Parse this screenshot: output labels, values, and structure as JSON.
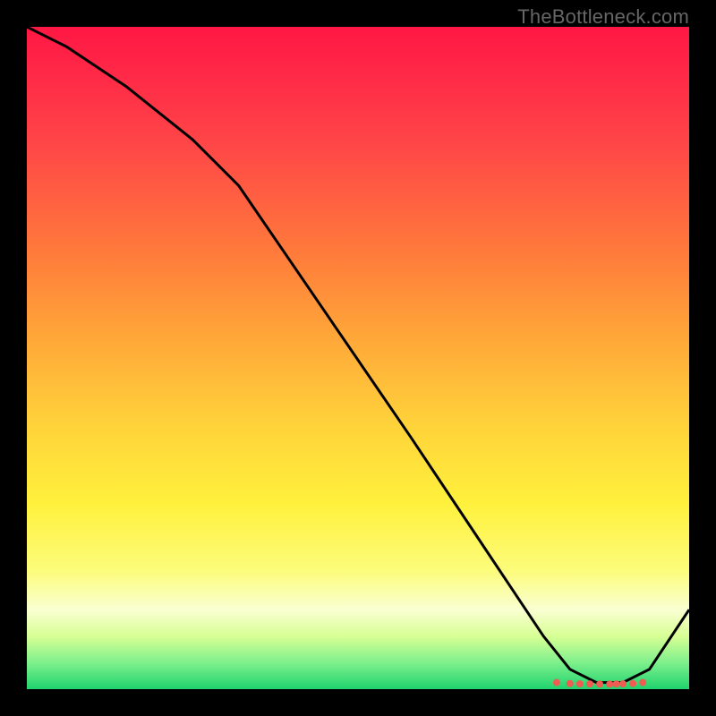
{
  "watermark": "TheBottleneck.com",
  "chart_data": {
    "type": "line",
    "title": "",
    "xlabel": "",
    "ylabel": "",
    "xlim": [
      0,
      100
    ],
    "ylim": [
      0,
      100
    ],
    "grid": false,
    "series": [
      {
        "name": "curve",
        "x": [
          0,
          6,
          15,
          25,
          32,
          45,
          58,
          70,
          78,
          82,
          86,
          90,
          94,
          100
        ],
        "values": [
          100,
          97,
          91,
          83,
          76,
          57,
          38,
          20,
          8,
          3,
          1,
          1,
          3,
          12
        ],
        "color": "#000000",
        "stroke_width": 3
      }
    ],
    "markers": {
      "x": [
        80,
        82,
        83.5,
        85,
        86.5,
        88,
        89,
        90,
        91.5,
        93
      ],
      "values": [
        1.0,
        0.85,
        0.8,
        0.78,
        0.76,
        0.76,
        0.78,
        0.8,
        0.85,
        1.0
      ],
      "color": "#f05b52",
      "radius": 4
    }
  }
}
